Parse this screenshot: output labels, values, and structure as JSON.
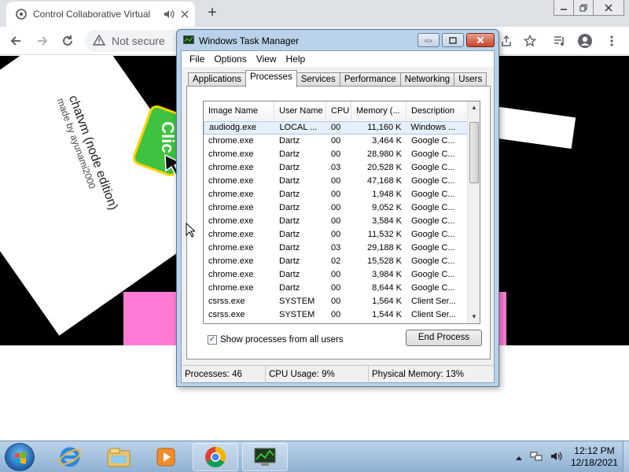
{
  "browser": {
    "tab_title": "Control Collaborative Virtual",
    "new_tab_label": "+",
    "security_label": "Not secure",
    "window_controls": [
      "minimize",
      "maximize",
      "close"
    ]
  },
  "page": {
    "vm_title": "chatvm (node edition)",
    "vm_subtitle": "made by ayunami2000",
    "click_button_text": "Clic"
  },
  "task_manager": {
    "title": "Windows Task Manager",
    "menu": [
      "File",
      "Options",
      "View",
      "Help"
    ],
    "tabs": [
      "Applications",
      "Processes",
      "Services",
      "Performance",
      "Networking",
      "Users"
    ],
    "active_tab": "Processes",
    "columns": [
      "Image Name",
      "User Name",
      "CPU",
      "Memory (...",
      "Description"
    ],
    "processes": [
      {
        "name": "audiodg.exe",
        "user": "LOCAL ...",
        "cpu": "00",
        "mem": "11,160 K",
        "desc": "Windows ..."
      },
      {
        "name": "chrome.exe",
        "user": "Dartz",
        "cpu": "00",
        "mem": "3,464 K",
        "desc": "Google C..."
      },
      {
        "name": "chrome.exe",
        "user": "Dartz",
        "cpu": "00",
        "mem": "28,980 K",
        "desc": "Google C..."
      },
      {
        "name": "chrome.exe",
        "user": "Dartz",
        "cpu": "03",
        "mem": "20,528 K",
        "desc": "Google C..."
      },
      {
        "name": "chrome.exe",
        "user": "Dartz",
        "cpu": "00",
        "mem": "47,168 K",
        "desc": "Google C..."
      },
      {
        "name": "chrome.exe",
        "user": "Dartz",
        "cpu": "00",
        "mem": "1,948 K",
        "desc": "Google C..."
      },
      {
        "name": "chrome.exe",
        "user": "Dartz",
        "cpu": "00",
        "mem": "9,052 K",
        "desc": "Google C..."
      },
      {
        "name": "chrome.exe",
        "user": "Dartz",
        "cpu": "00",
        "mem": "3,584 K",
        "desc": "Google C..."
      },
      {
        "name": "chrome.exe",
        "user": "Dartz",
        "cpu": "00",
        "mem": "11,532 K",
        "desc": "Google C..."
      },
      {
        "name": "chrome.exe",
        "user": "Dartz",
        "cpu": "03",
        "mem": "29,188 K",
        "desc": "Google C..."
      },
      {
        "name": "chrome.exe",
        "user": "Dartz",
        "cpu": "02",
        "mem": "15,528 K",
        "desc": "Google C..."
      },
      {
        "name": "chrome.exe",
        "user": "Dartz",
        "cpu": "00",
        "mem": "3,984 K",
        "desc": "Google C..."
      },
      {
        "name": "chrome.exe",
        "user": "Dartz",
        "cpu": "00",
        "mem": "8,644 K",
        "desc": "Google C..."
      },
      {
        "name": "csrss.exe",
        "user": "SYSTEM",
        "cpu": "00",
        "mem": "1,564 K",
        "desc": "Client Ser..."
      },
      {
        "name": "csrss.exe",
        "user": "SYSTEM",
        "cpu": "00",
        "mem": "1,544 K",
        "desc": "Client Ser..."
      }
    ],
    "show_all_label": "Show processes from all users",
    "show_all_checked": true,
    "end_process_label": "End Process",
    "status": {
      "processes": "Processes: 46",
      "cpu": "CPU Usage: 9%",
      "memory": "Physical Memory: 13%"
    }
  },
  "taskbar": {
    "time": "12:12 PM",
    "date": "12/18/2021",
    "items": [
      "internet-explorer",
      "windows-explorer",
      "media-player",
      "chrome",
      "task-manager"
    ]
  },
  "colors": {
    "pink": "#ff7bd5",
    "selection": "#e6f0fb",
    "task_manager_frame": "#b9d1ea"
  }
}
